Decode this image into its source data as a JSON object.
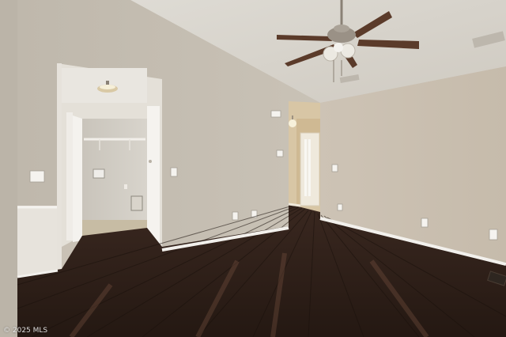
{
  "photo": {
    "watermark": "© 2025 MLS"
  },
  "colors": {
    "ceiling": "#d9d5cd",
    "wall_left": "#c4bdb1",
    "wall_right": "#cbc1b3",
    "baseboard": "#f2f0ec",
    "floor_dark": "#2a1d17",
    "floor_light": "#5a3d2f",
    "fan_blade": "#5b3b2a",
    "fan_metal": "#9a9186"
  },
  "icons": {
    "ceiling_fan": "ceiling-fan-icon",
    "light": "light-fixture-icon"
  }
}
